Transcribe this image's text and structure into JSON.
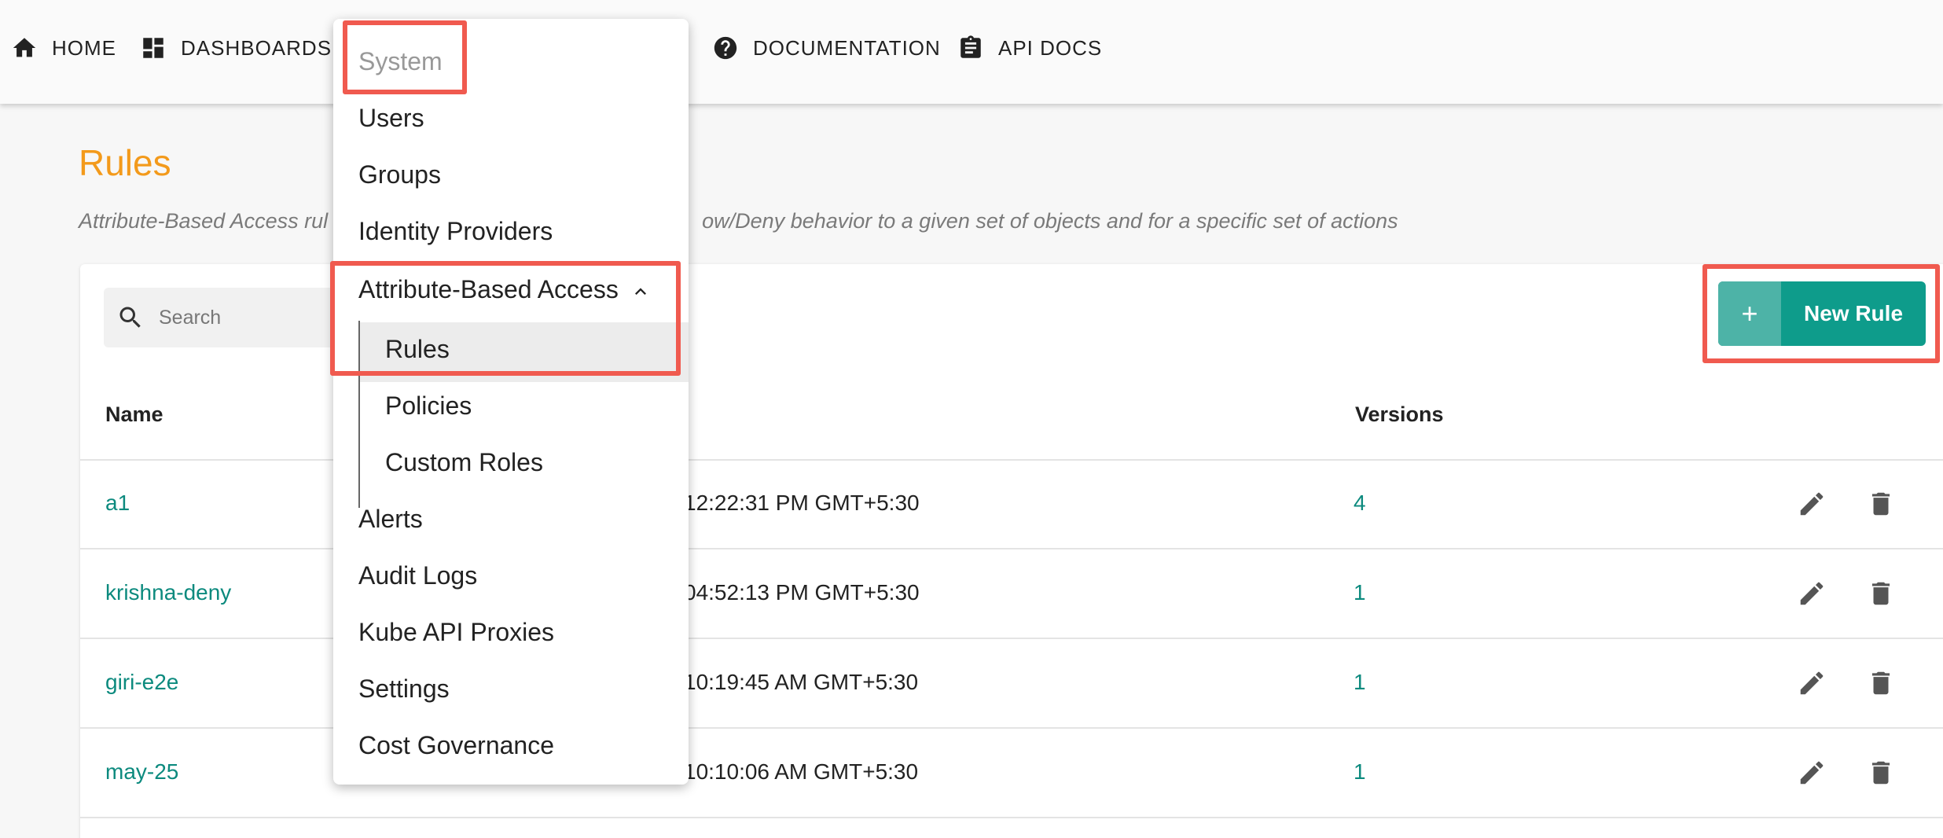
{
  "nav": {
    "home": "HOME",
    "dashboards": "DASHBOARDS",
    "documentation": "DOCUMENTATION",
    "api_docs": "API DOCS"
  },
  "page": {
    "title": "Rules",
    "subtitle_left": "Attribute-Based Access rul",
    "subtitle_right": "ow/Deny behavior to a given set of objects and for a specific set of actions"
  },
  "search": {
    "placeholder": "Search"
  },
  "new_rule_button": {
    "icon": "+",
    "label": "New Rule"
  },
  "table": {
    "headers": {
      "name": "Name",
      "versions": "Versions"
    },
    "rows": [
      {
        "name": "a1",
        "date": "12:22:31 PM GMT+5:30",
        "versions": "4"
      },
      {
        "name": "krishna-deny",
        "date": "04:52:13 PM GMT+5:30",
        "versions": "1"
      },
      {
        "name": "giri-e2e",
        "date": "10:19:45 AM GMT+5:30",
        "versions": "1"
      },
      {
        "name": "may-25",
        "date": "10:10:06 AM GMT+5:30",
        "versions": "1"
      }
    ]
  },
  "menu": {
    "header": "System",
    "items": [
      "Users",
      "Groups",
      "Identity Providers"
    ],
    "abac_group": "Attribute-Based Access",
    "abac_children": [
      "Rules",
      "Policies",
      "Custom Roles"
    ],
    "items_after": [
      "Alerts",
      "Audit Logs",
      "Kube API Proxies",
      "Settings",
      "Cost Governance"
    ]
  },
  "colors": {
    "accent": "#0e9c8b",
    "title": "#f39a1b",
    "highlight": "#f05a4f"
  }
}
